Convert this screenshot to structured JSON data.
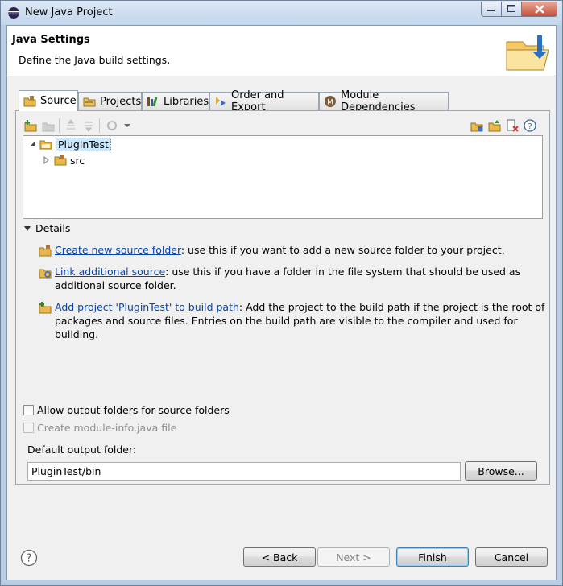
{
  "window": {
    "title": "New Java Project"
  },
  "header": {
    "title": "Java Settings",
    "description": "Define the Java build settings."
  },
  "tabs": [
    {
      "label": "Source",
      "icon": "source-folder-icon",
      "active": true
    },
    {
      "label": "Projects",
      "icon": "projects-icon",
      "active": false
    },
    {
      "label": "Libraries",
      "icon": "libraries-icon",
      "active": false
    },
    {
      "label": "Order and Export",
      "icon": "order-export-icon",
      "active": false
    },
    {
      "label": "Module Dependencies",
      "icon": "module-icon",
      "active": false
    }
  ],
  "tree": {
    "items": [
      {
        "label": "PluginTest",
        "expanded": true,
        "selected": true
      },
      {
        "label": "src",
        "expanded": false,
        "selected": false
      }
    ]
  },
  "details": {
    "header": "Details",
    "items": [
      {
        "link": "Create new source folder",
        "text": ": use this if you want to add a new source folder to your project."
      },
      {
        "link": "Link additional source",
        "text": ": use this if you have a folder in the file system that should be used as additional source folder."
      },
      {
        "link": "Add project 'PluginTest' to build path",
        "text": ": Add the project to the build path if the project is the root of packages and source files. Entries on the build path are visible to the compiler and used for building."
      }
    ]
  },
  "options": {
    "allow_output": "Allow output folders for source folders",
    "create_module_info": "Create module-info.java file"
  },
  "output": {
    "label": "Default output folder:",
    "value": "PluginTest/bin",
    "browse": "Browse..."
  },
  "buttons": {
    "back": "< Back",
    "next": "Next >",
    "finish": "Finish",
    "cancel": "Cancel"
  },
  "colors": {
    "link": "#0645ad",
    "selection": "#cce8ff",
    "dialog_bg": "#f0f0f0"
  }
}
